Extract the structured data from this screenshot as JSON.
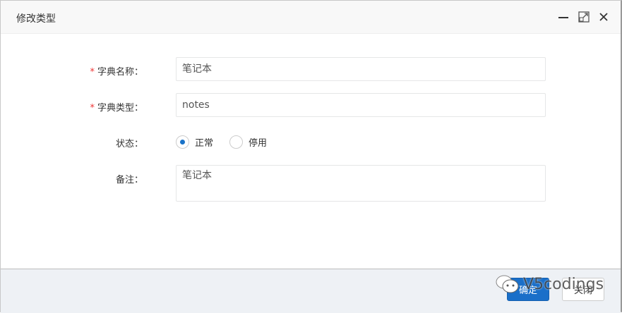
{
  "dialog": {
    "title": "修改类型"
  },
  "form": {
    "dict_name": {
      "label": "字典名称：",
      "value": "笔记本",
      "required": "*"
    },
    "dict_type": {
      "label": "字典类型：",
      "value": "notes",
      "required": "*"
    },
    "status": {
      "label": "状态：",
      "options": [
        "正常",
        "停用"
      ],
      "selected": "正常"
    },
    "remark": {
      "label": "备注：",
      "value": "笔记本"
    }
  },
  "footer": {
    "confirm": "确定",
    "close": "关闭"
  },
  "watermark": "V5codings",
  "colors": {
    "primary": "#1a6fc9",
    "required": "#e33333"
  }
}
